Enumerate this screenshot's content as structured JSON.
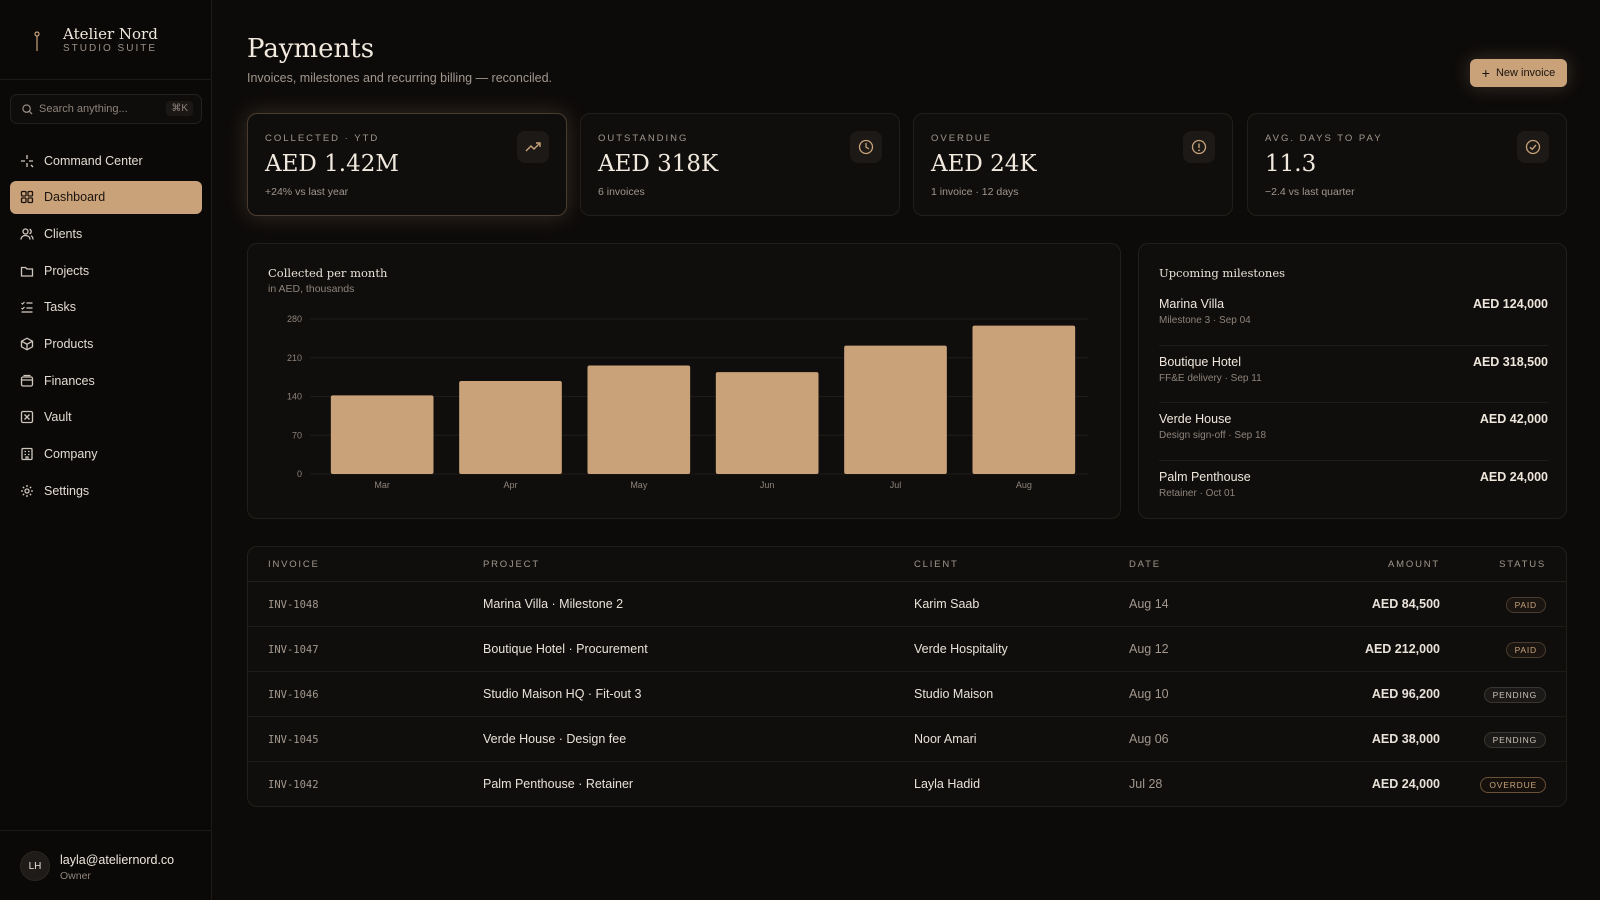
{
  "brand": {
    "name": "Atelier Nord",
    "subtitle": "STUDIO SUITE"
  },
  "search": {
    "placeholder": "Search anything...",
    "shortcut": "⌘K"
  },
  "nav": [
    {
      "label": "Command Center",
      "icon": "sparkle-icon",
      "active": false
    },
    {
      "label": "Dashboard",
      "icon": "grid-icon",
      "active": true
    },
    {
      "label": "Clients",
      "icon": "users-icon",
      "active": false
    },
    {
      "label": "Projects",
      "icon": "folder-icon",
      "active": false
    },
    {
      "label": "Tasks",
      "icon": "list-check-icon",
      "active": false
    },
    {
      "label": "Products",
      "icon": "box-icon",
      "active": false
    },
    {
      "label": "Finances",
      "icon": "wallet-icon",
      "active": false
    },
    {
      "label": "Vault",
      "icon": "vault-icon",
      "active": false
    },
    {
      "label": "Company",
      "icon": "building-icon",
      "active": false
    },
    {
      "label": "Settings",
      "icon": "gear-icon",
      "active": false
    }
  ],
  "user": {
    "initials": "LH",
    "email": "layla@ateliernord.co",
    "role": "Owner"
  },
  "header": {
    "title": "Payments",
    "subtitle": "Invoices, milestones and recurring billing — reconciled.",
    "new_button": "New invoice"
  },
  "stats": [
    {
      "label": "COLLECTED · YTD",
      "value": "AED 1.42M",
      "note": "+24% vs last year",
      "icon": "trend-up-icon"
    },
    {
      "label": "OUTSTANDING",
      "value": "AED 318K",
      "note": "6 invoices",
      "icon": "clock-icon"
    },
    {
      "label": "OVERDUE",
      "value": "AED 24K",
      "note": "1 invoice · 12 days",
      "icon": "alert-icon"
    },
    {
      "label": "AVG. DAYS TO PAY",
      "value": "11.3",
      "note": "−2.4 vs last quarter",
      "icon": "check-circle-icon"
    }
  ],
  "chart_data": {
    "type": "bar",
    "title": "Collected per month",
    "subtitle": "in AED, thousands",
    "categories": [
      "Mar",
      "Apr",
      "May",
      "Jun",
      "Jul",
      "Aug"
    ],
    "values": [
      142,
      168,
      196,
      184,
      232,
      268
    ],
    "yticks": [
      0,
      70,
      140,
      210,
      280
    ],
    "ylim": [
      0,
      280
    ],
    "grid": true,
    "color": "#c9a27a"
  },
  "milestones": {
    "title": "Upcoming milestones",
    "items": [
      {
        "name": "Marina Villa",
        "detail": "Milestone 3 · Sep 04",
        "amount": "AED 124,000"
      },
      {
        "name": "Boutique Hotel",
        "detail": "FF&E delivery · Sep 11",
        "amount": "AED 318,500"
      },
      {
        "name": "Verde House",
        "detail": "Design sign-off · Sep 18",
        "amount": "AED 42,000"
      },
      {
        "name": "Palm Penthouse",
        "detail": "Retainer · Oct 01",
        "amount": "AED 24,000"
      }
    ]
  },
  "table": {
    "headers": {
      "invoice": "INVOICE",
      "project": "PROJECT",
      "client": "CLIENT",
      "date": "DATE",
      "amount": "AMOUNT",
      "status": "STATUS"
    },
    "rows": [
      {
        "invoice": "INV-1048",
        "project": "Marina Villa · Milestone 2",
        "client": "Karim Saab",
        "date": "Aug 14",
        "amount": "AED 84,500",
        "status": "PAID"
      },
      {
        "invoice": "INV-1047",
        "project": "Boutique Hotel · Procurement",
        "client": "Verde Hospitality",
        "date": "Aug 12",
        "amount": "AED 212,000",
        "status": "PAID"
      },
      {
        "invoice": "INV-1046",
        "project": "Studio Maison HQ · Fit-out 3",
        "client": "Studio Maison",
        "date": "Aug 10",
        "amount": "AED 96,200",
        "status": "PENDING"
      },
      {
        "invoice": "INV-1045",
        "project": "Verde House · Design fee",
        "client": "Noor Amari",
        "date": "Aug 06",
        "amount": "AED 38,000",
        "status": "PENDING"
      },
      {
        "invoice": "INV-1042",
        "project": "Palm Penthouse · Retainer",
        "client": "Layla Hadid",
        "date": "Jul 28",
        "amount": "AED 24,000",
        "status": "OVERDUE"
      }
    ]
  }
}
